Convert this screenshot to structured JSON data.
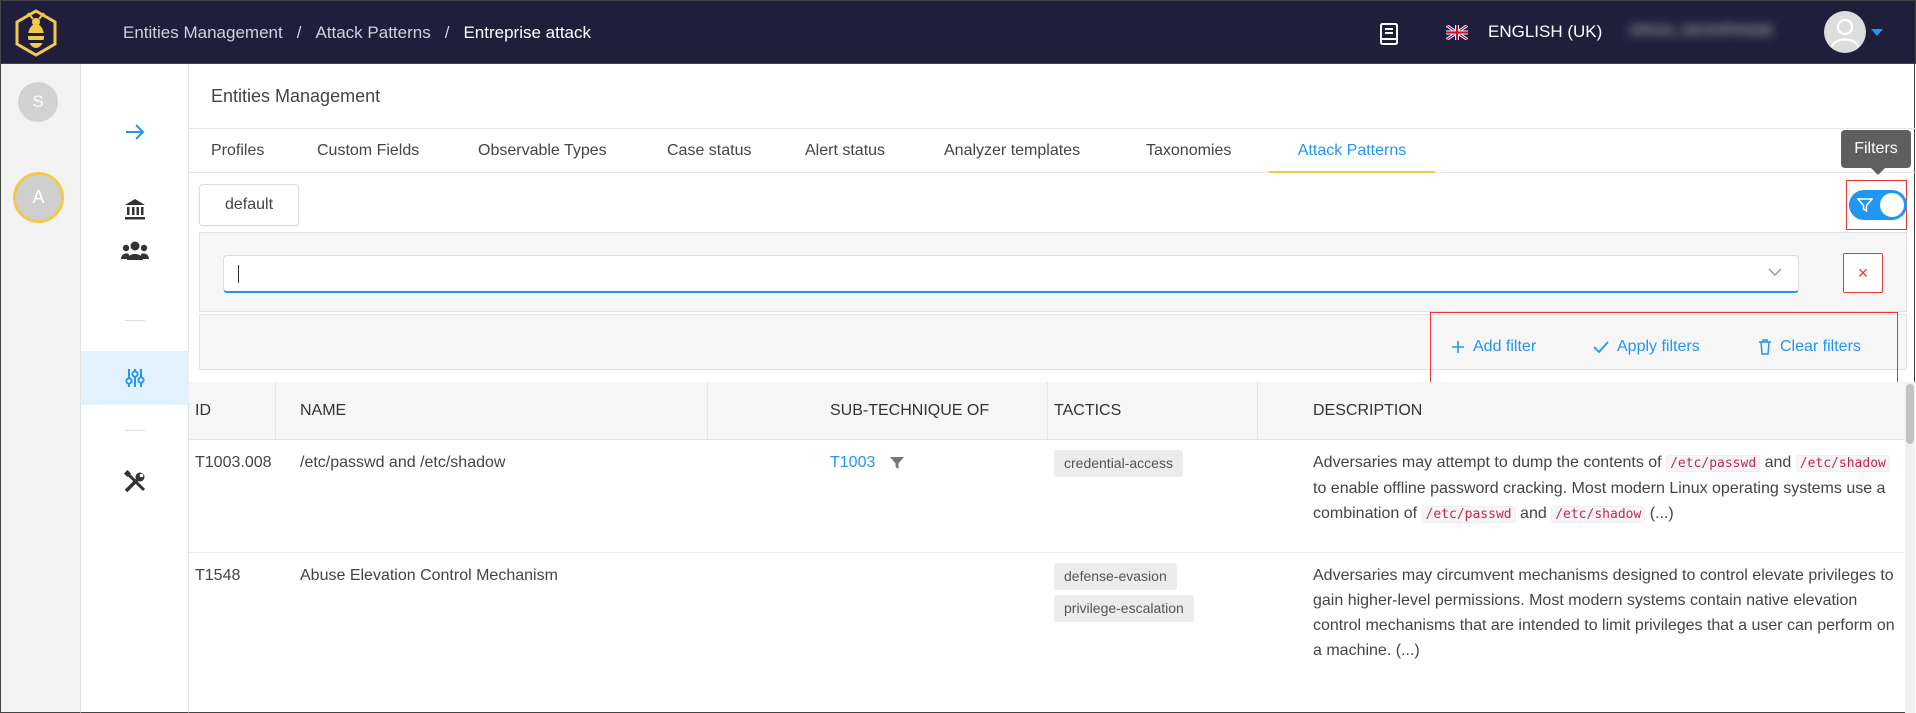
{
  "breadcrumb": {
    "items": [
      "Entities Management",
      "Attack Patterns",
      "Entreprise attack"
    ],
    "separator": "/"
  },
  "topbar": {
    "language": "ENGLISH (UK)",
    "username": "ARSAL DESHPANDE"
  },
  "orgs": [
    {
      "initial": "S"
    },
    {
      "initial": "A"
    }
  ],
  "page": {
    "title": "Entities Management"
  },
  "tabs": [
    "Profiles",
    "Custom Fields",
    "Observable Types",
    "Case status",
    "Alert status",
    "Analyzer templates",
    "Taxonomies",
    "Attack Patterns"
  ],
  "active_tab": "Attack Patterns",
  "tooltip": "Filters",
  "preset": "default",
  "filter": {
    "value": "",
    "remove": "×"
  },
  "actions": {
    "add": "Add filter",
    "apply": "Apply filters",
    "clear": "Clear filters"
  },
  "table": {
    "headers": [
      "ID",
      "NAME",
      "SUB-TECHNIQUE OF",
      "TACTICS",
      "DESCRIPTION"
    ],
    "rows": [
      {
        "id": "T1003.008",
        "name": "/etc/passwd and /etc/shadow",
        "sub": "T1003",
        "tactics": [
          "credential-access"
        ],
        "desc": {
          "p1": "Adversaries may attempt to dump the contents of ",
          "c1": "/etc/passwd",
          "p2": " and ",
          "c2": "/etc/shadow",
          "p3": " to enable offline password cracking. Most modern Linux operating systems use a combination of ",
          "c3": "/etc/passwd",
          "p4": " and ",
          "c4": "/etc/shadow",
          "p5": " (...)"
        }
      },
      {
        "id": "T1548",
        "name": "Abuse Elevation Control Mechanism",
        "sub": "",
        "tactics": [
          "defense-evasion",
          "privilege-escalation"
        ],
        "desc": "Adversaries may circumvent mechanisms designed to control elevate privileges to gain higher-level permissions. Most modern systems contain native elevation control mechanisms that are intended to limit privileges that a user can perform on a machine. (...)"
      }
    ]
  },
  "colors": {
    "topbar": "#1f1f3b",
    "accent": "#2196f3",
    "tab_underline": "#f2c94c",
    "highlight_box": "#e53935"
  }
}
